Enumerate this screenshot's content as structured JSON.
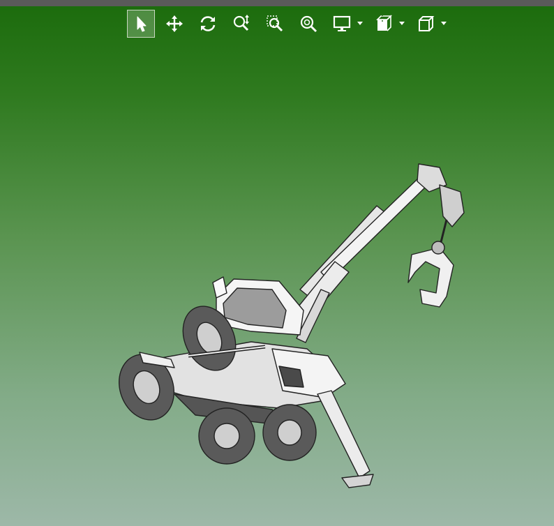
{
  "toolbar": {
    "tools": [
      {
        "id": "select",
        "icon": "select-arrow-icon",
        "active": true
      },
      {
        "id": "pan",
        "icon": "pan-move-icon",
        "active": false
      },
      {
        "id": "rotate",
        "icon": "rotate-icon",
        "active": false
      },
      {
        "id": "zoom",
        "icon": "zoom-icon",
        "active": false
      },
      {
        "id": "zoom-window",
        "icon": "zoom-window-icon",
        "active": false
      },
      {
        "id": "zoom-fit",
        "icon": "zoom-fit-icon",
        "active": false
      },
      {
        "id": "display",
        "icon": "monitor-icon",
        "has_dropdown": true
      },
      {
        "id": "section",
        "icon": "section-view-icon",
        "has_dropdown": true
      },
      {
        "id": "view-orientation",
        "icon": "cube-view-icon",
        "has_dropdown": true
      }
    ]
  },
  "viewport": {
    "background_top": "#1b6b0c",
    "background_bottom": "#9db8a8",
    "model": "forestry-harvester-3d-model"
  }
}
